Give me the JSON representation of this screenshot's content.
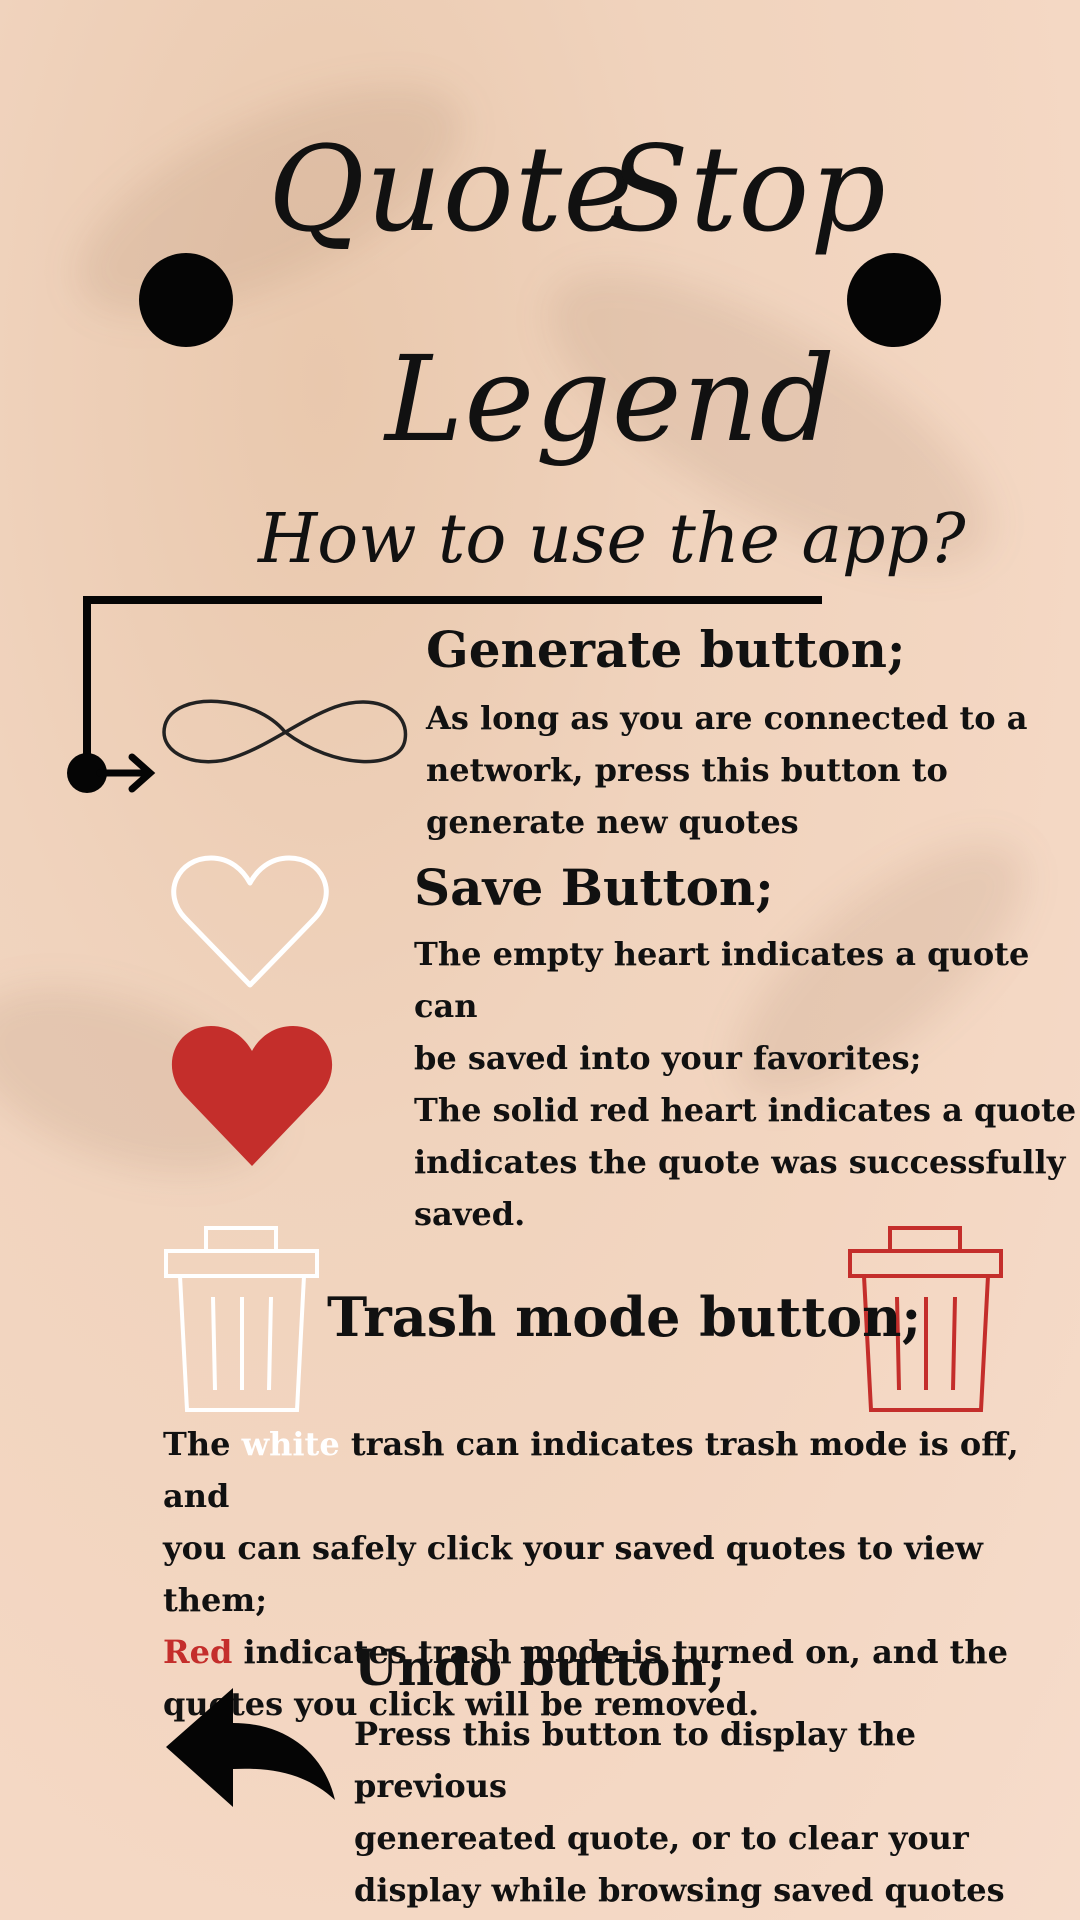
{
  "title": {
    "word1": "Quote",
    "word2": "Stop",
    "word3": "Legend"
  },
  "subtitle": "How to use the app?",
  "generate": {
    "heading": "Generate button;",
    "lines": [
      "As long as you are connected to a",
      "network, press this button to",
      "generate new quotes"
    ]
  },
  "save": {
    "heading": "Save Button;",
    "lines": [
      "The empty heart indicates a quote can",
      "be saved into your favorites;",
      "The solid red heart indicates a quote",
      "indicates the quote was successfully",
      "saved."
    ]
  },
  "trash": {
    "heading": "Trash mode button;",
    "line1_pre": "The ",
    "line1_white": "white",
    "line1_post": " trash can indicates trash mode is off, and",
    "line2": "you can safely click your saved quotes to view them;",
    "line3_red": "Red",
    "line3_post": " indicates trash mode is turned on, and the",
    "line4": "quotes you click will be removed."
  },
  "undo": {
    "heading": "Undo button;",
    "lines": [
      "Press this button to display the previous",
      "genereated quote, or to clear your",
      "display while browsing saved quotes"
    ]
  },
  "colors": {
    "accent_red": "#c42e2b",
    "white": "#ffffff",
    "ink": "#050505"
  },
  "icons": [
    "infinity-icon",
    "heart-outline-icon",
    "heart-filled-icon",
    "trash-white-icon",
    "trash-red-icon",
    "undo-arrow-icon"
  ]
}
